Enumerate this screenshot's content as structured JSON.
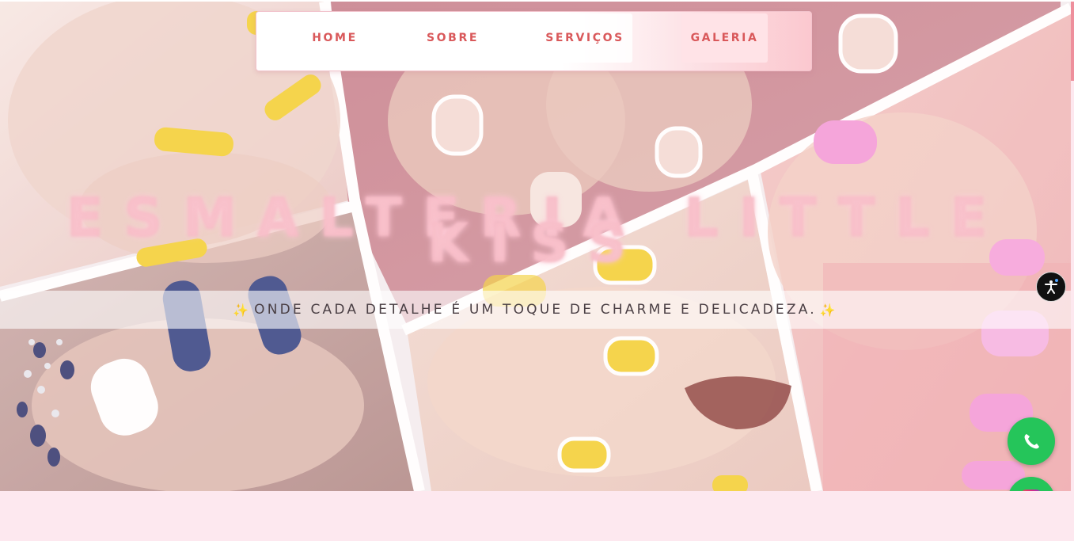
{
  "nav": {
    "items": [
      {
        "label": "HOME"
      },
      {
        "label": "SOBRE"
      },
      {
        "label": "SERVIÇOS"
      },
      {
        "label": "GALERIA"
      }
    ]
  },
  "hero": {
    "title_line1": "ESMALTERIA LITTLE",
    "title_line2": "KISS",
    "tagline": "ONDE CADA DETALHE É UM TOQUE DE CHARME E DELICADEZA.",
    "sparkle": "✨"
  },
  "icons": {
    "accessibility": "accessibility-icon",
    "whatsapp": "whatsapp-icon",
    "instagram": "instagram-icon"
  },
  "colors": {
    "nav_text": "#d9585a",
    "page_background": "#fde8ef",
    "whatsapp_green": "#25c55a"
  }
}
